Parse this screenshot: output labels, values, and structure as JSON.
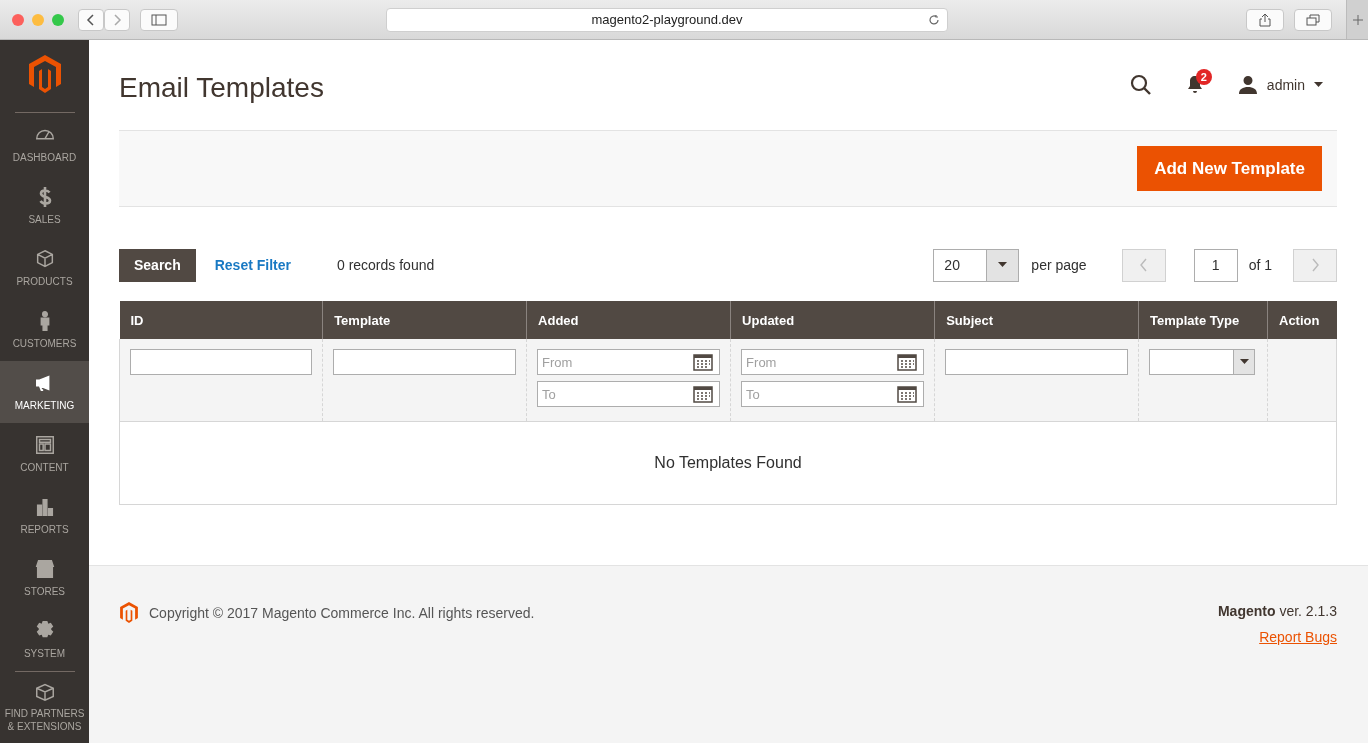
{
  "browser": {
    "url": "magento2-playground.dev"
  },
  "sidebar": {
    "items": [
      {
        "label": "DASHBOARD",
        "selected": false
      },
      {
        "label": "SALES",
        "selected": false
      },
      {
        "label": "PRODUCTS",
        "selected": false
      },
      {
        "label": "CUSTOMERS",
        "selected": false
      },
      {
        "label": "MARKETING",
        "selected": true
      },
      {
        "label": "CONTENT",
        "selected": false
      },
      {
        "label": "REPORTS",
        "selected": false
      },
      {
        "label": "STORES",
        "selected": false
      },
      {
        "label": "SYSTEM",
        "selected": false
      },
      {
        "label": "FIND PARTNERS & EXTENSIONS",
        "selected": false
      }
    ]
  },
  "header": {
    "title": "Email Templates",
    "notifications": "2",
    "user": "admin"
  },
  "actions": {
    "primary": "Add New Template"
  },
  "toolbar": {
    "search": "Search",
    "reset": "Reset Filter",
    "records": "0 records found",
    "per_page_value": "20",
    "per_page_label": "per page",
    "page": "1",
    "page_of": "of 1"
  },
  "table": {
    "columns": [
      {
        "label": "ID",
        "kind": "text"
      },
      {
        "label": "Template",
        "kind": "text"
      },
      {
        "label": "Added",
        "kind": "daterange",
        "from": "From",
        "to": "To"
      },
      {
        "label": "Updated",
        "kind": "daterange",
        "from": "From",
        "to": "To"
      },
      {
        "label": "Subject",
        "kind": "text"
      },
      {
        "label": "Template Type",
        "kind": "select"
      },
      {
        "label": "Action",
        "kind": "none"
      }
    ],
    "empty": "No Templates Found"
  },
  "footer": {
    "copyright": "Copyright © 2017 Magento Commerce Inc. All rights reserved.",
    "brand": "Magento",
    "version": " ver. 2.1.3",
    "report": "Report Bugs"
  }
}
